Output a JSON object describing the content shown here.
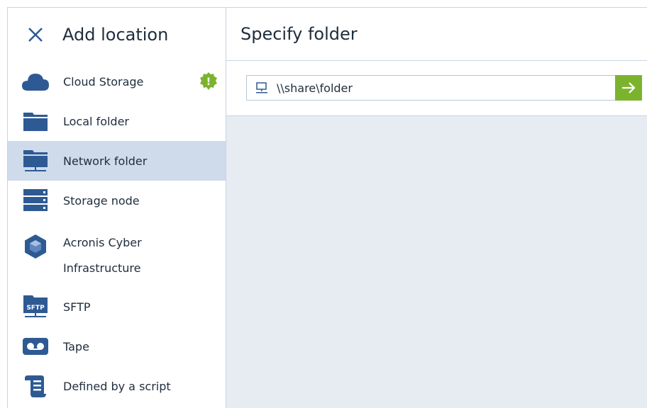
{
  "sidebar": {
    "title": "Add location",
    "items": [
      {
        "label": "Cloud Storage",
        "icon": "cloud-icon",
        "badge": "!"
      },
      {
        "label": "Local folder",
        "icon": "folder-icon"
      },
      {
        "label": "Network folder",
        "icon": "network-folder-icon",
        "active": true
      },
      {
        "label": "Storage node",
        "icon": "server-icon"
      },
      {
        "label": "Acronis Cyber Infrastructure",
        "icon": "cube-icon"
      },
      {
        "label": "SFTP",
        "icon": "sftp-icon",
        "icon_text": "SFTP"
      },
      {
        "label": "Tape",
        "icon": "tape-icon"
      },
      {
        "label": "Defined by a script",
        "icon": "script-icon"
      }
    ]
  },
  "main": {
    "title": "Specify folder",
    "path_value": "\\\\share\\folder"
  },
  "colors": {
    "accent": "#2e5a94",
    "active_bg": "#cfdbeb",
    "go_button": "#7cb32e",
    "panel_bg": "#e7ecf3"
  }
}
